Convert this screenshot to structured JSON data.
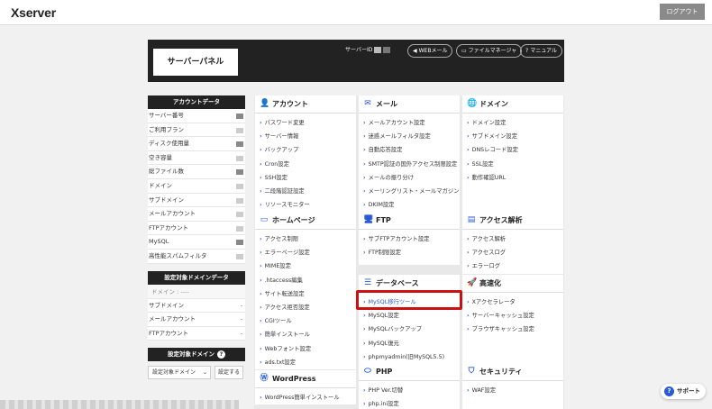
{
  "topbar": {
    "logo": "Xserver",
    "logout": "ログアウト"
  },
  "header": {
    "panel_title": "サーバーパネル",
    "server_id_label": "サーバーID",
    "buttons": [
      {
        "label": "WEBメール",
        "icon": "◀"
      },
      {
        "label": "ファイルマネージャ",
        "icon": "▭"
      },
      {
        "label": "マニュアル",
        "icon": "?"
      }
    ]
  },
  "sidebar": {
    "account_title": "アカウントデータ",
    "account_rows": [
      "サーバー番号",
      "ご利用プラン",
      "ディスク使用量",
      "空き容量",
      "総ファイル数",
      "ドメイン",
      "サブドメイン",
      "メールアカウント",
      "FTPアカウント",
      "MySQL",
      "高性能スパムフィルタ"
    ],
    "target_title": "設定対象ドメインデータ",
    "domain_label": "ドメイン : ----",
    "target_rows": [
      {
        "label": "サブドメイン",
        "value": "-"
      },
      {
        "label": "メールアカウント",
        "value": "-"
      },
      {
        "label": "FTPアカウント",
        "value": "-"
      }
    ],
    "target_domain_title": "設定対象ドメイン",
    "select_value": "設定対象ドメイン",
    "set_button": "設定する"
  },
  "sections": {
    "account": {
      "title": "アカウント",
      "icon": "person-icon",
      "items": [
        "パスワード変更",
        "サーバー情報",
        "バックアップ",
        "Cron設定",
        "SSH設定",
        "二段階認証設定",
        "リソースモニター"
      ]
    },
    "homepage": {
      "title": "ホームページ",
      "icon": "browser-icon",
      "items": [
        "アクセス制限",
        "エラーページ設定",
        "MIME設定",
        ".htaccess編集",
        "サイト転送設定",
        "アクセス拒否設定",
        "CGIツール",
        "簡単インストール",
        "Webフォント設定",
        "ads.txt設定"
      ]
    },
    "wordpress": {
      "title": "WordPress",
      "icon": "wordpress-icon",
      "items": [
        "WordPress簡単インストール"
      ]
    },
    "mail": {
      "title": "メール",
      "icon": "mail-icon",
      "items": [
        "メールアカウント設定",
        "迷惑メールフィルタ設定",
        "自動応答設定",
        "SMTP認証の国外アクセス制限設定",
        "メールの振り分け",
        "メーリングリスト・メールマガジン",
        "DKIM設定"
      ]
    },
    "ftp": {
      "title": "FTP",
      "icon": "monitor-icon",
      "items": [
        "サブFTPアカウント設定",
        "FTP制限設定"
      ]
    },
    "database": {
      "title": "データベース",
      "icon": "database-icon",
      "items": [
        "MySQL移行ツール",
        "MySQL設定",
        "MySQLバックアップ",
        "MySQL復元",
        "phpmyadmin(旧MySQL5.5)"
      ]
    },
    "php": {
      "title": "PHP",
      "icon": "php-icon",
      "items": [
        "PHP Ver.切替",
        "php.ini設定"
      ]
    },
    "domain": {
      "title": "ドメイン",
      "icon": "globe-icon",
      "items": [
        "ドメイン設定",
        "サブドメイン設定",
        "DNSレコード設定",
        "SSL設定",
        "動作確認URL"
      ]
    },
    "analytics": {
      "title": "アクセス解析",
      "icon": "chart-icon",
      "items": [
        "アクセス解析",
        "アクセスログ",
        "エラーログ"
      ]
    },
    "speed": {
      "title": "高速化",
      "icon": "rocket-icon",
      "items": [
        "Xアクセラレータ",
        "サーバーキャッシュ設定",
        "ブラウザキャッシュ設定"
      ]
    },
    "security": {
      "title": "セキュリティ",
      "icon": "shield-icon",
      "items": [
        "WAF設定"
      ]
    }
  },
  "support": "サポート",
  "colors": {
    "accent": "#2a5bd7",
    "highlight": "#cc1010",
    "header": "#222222"
  }
}
